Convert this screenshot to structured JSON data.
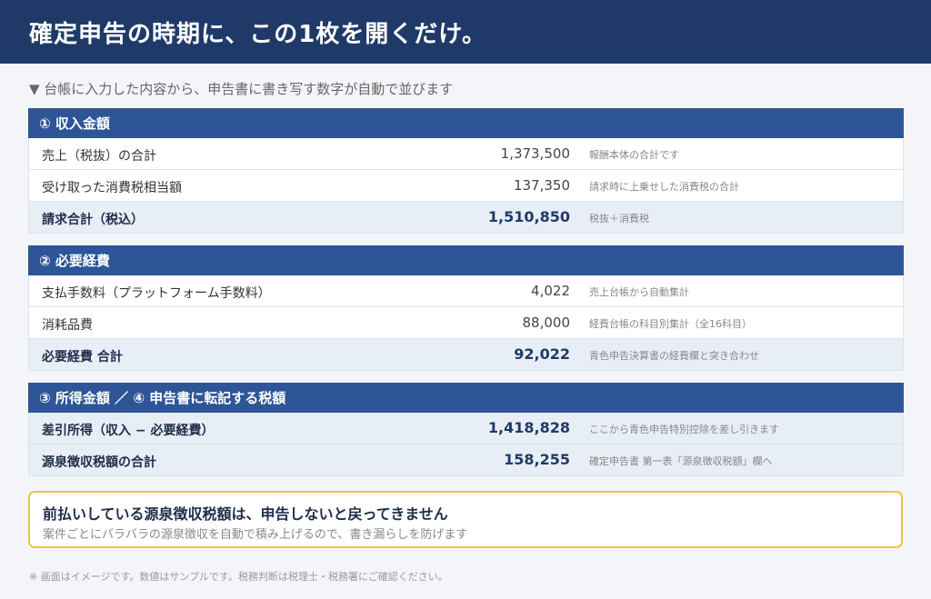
{
  "header": {
    "title": "確定申告の時期に、この1枚を開くだけ。"
  },
  "lead": "▼ 台帳に入力した内容から、申告書に書き写す数字が自動で並びます",
  "sections": [
    {
      "title": "① 収入金額",
      "rows": [
        {
          "label": "売上（税抜）の合計",
          "amount": "1,373,500",
          "note": "報酬本体の合計です",
          "total": false
        },
        {
          "label": "受け取った消費税相当額",
          "amount": "137,350",
          "note": "請求時に上乗せした消費税の合計",
          "total": false
        },
        {
          "label": "請求合計（税込）",
          "amount": "1,510,850",
          "note": "税抜＋消費税",
          "total": true
        }
      ]
    },
    {
      "title": "② 必要経費",
      "rows": [
        {
          "label": "支払手数料（プラットフォーム手数料）",
          "amount": "4,022",
          "note": "売上台帳から自動集計",
          "total": false
        },
        {
          "label": "消耗品費",
          "amount": "88,000",
          "note": "経費台帳の科目別集計（全16科目）",
          "total": false
        },
        {
          "label": "必要経費 合計",
          "amount": "92,022",
          "note": "青色申告決算書の経費欄と突き合わせ",
          "total": true
        }
      ]
    },
    {
      "title": "③ 所得金額 ／ ④ 申告書に転記する税額",
      "rows": [
        {
          "label": "差引所得（収入 − 必要経費）",
          "amount": "1,418,828",
          "note": "ここから青色申告特別控除を差し引きます",
          "total": true
        },
        {
          "label": "源泉徴収税額の合計",
          "amount": "158,255",
          "note": "確定申告書 第一表「源泉徴収税額」欄へ",
          "total": true
        }
      ]
    }
  ],
  "callout": {
    "title": "前払いしている源泉徴収税額は、申告しないと戻ってきません",
    "sub": "案件ごとにバラバラの源泉徴収を自動で積み上げるので、書き漏らしを防げます"
  },
  "footnote": "※ 画面はイメージです。数値はサンプルです。税務判断は税理士・税務署にご確認ください。"
}
